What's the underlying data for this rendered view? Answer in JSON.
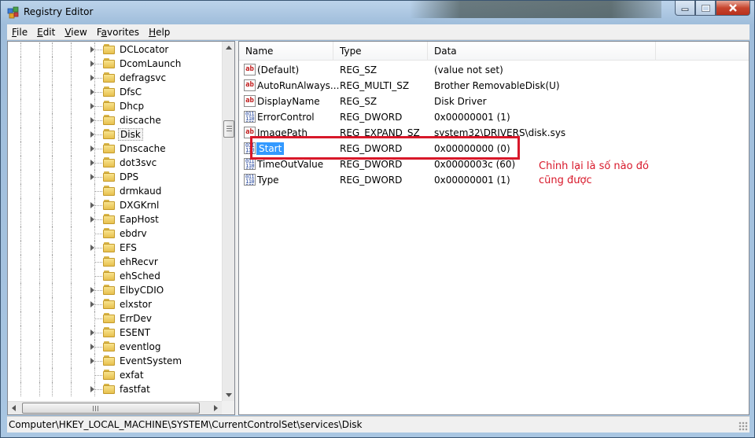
{
  "window": {
    "title": "Registry Editor",
    "app_icon": "registry-editor-icon",
    "buttons": {
      "minimize": "minimize-icon",
      "maximize": "maximize-icon",
      "close": "close-icon"
    }
  },
  "menu": [
    {
      "label": "File",
      "accel": "F",
      "rest": "ile"
    },
    {
      "label": "Edit",
      "accel": "E",
      "rest": "dit"
    },
    {
      "label": "View",
      "accel": "V",
      "rest": "iew"
    },
    {
      "label": "Favorites",
      "accel": "",
      "rest": "Favorites",
      "accel_index_note": "a"
    },
    {
      "label": "Help",
      "accel": "H",
      "rest": "elp"
    }
  ],
  "tree": {
    "items": [
      {
        "label": "DCLocator",
        "expandable": true
      },
      {
        "label": "DcomLaunch",
        "expandable": true
      },
      {
        "label": "defragsvc",
        "expandable": true
      },
      {
        "label": "DfsC",
        "expandable": true
      },
      {
        "label": "Dhcp",
        "expandable": true
      },
      {
        "label": "discache",
        "expandable": true
      },
      {
        "label": "Disk",
        "expandable": true,
        "selected": true
      },
      {
        "label": "Dnscache",
        "expandable": true
      },
      {
        "label": "dot3svc",
        "expandable": true
      },
      {
        "label": "DPS",
        "expandable": true
      },
      {
        "label": "drmkaud",
        "expandable": false
      },
      {
        "label": "DXGKrnl",
        "expandable": true
      },
      {
        "label": "EapHost",
        "expandable": true
      },
      {
        "label": "ebdrv",
        "expandable": false
      },
      {
        "label": "EFS",
        "expandable": true
      },
      {
        "label": "ehRecvr",
        "expandable": false
      },
      {
        "label": "ehSched",
        "expandable": false
      },
      {
        "label": "ElbyCDIO",
        "expandable": true
      },
      {
        "label": "elxstor",
        "expandable": true
      },
      {
        "label": "ErrDev",
        "expandable": false
      },
      {
        "label": "ESENT",
        "expandable": true
      },
      {
        "label": "eventlog",
        "expandable": true
      },
      {
        "label": "EventSystem",
        "expandable": true
      },
      {
        "label": "exfat",
        "expandable": false
      },
      {
        "label": "fastfat",
        "expandable": true
      }
    ]
  },
  "list": {
    "columns": [
      "Name",
      "Type",
      "Data"
    ],
    "rows": [
      {
        "name": "(Default)",
        "type": "REG_SZ",
        "data": "(value not set)",
        "icon": "string-value-icon"
      },
      {
        "name": "AutoRunAlways...",
        "type": "REG_MULTI_SZ",
        "data": "Brother RemovableDisk(U)",
        "icon": "string-value-icon"
      },
      {
        "name": "DisplayName",
        "type": "REG_SZ",
        "data": "Disk Driver",
        "icon": "string-value-icon"
      },
      {
        "name": "ErrorControl",
        "type": "REG_DWORD",
        "data": "0x00000001 (1)",
        "icon": "binary-value-icon"
      },
      {
        "name": "ImagePath",
        "type": "REG_EXPAND_SZ",
        "data": "system32\\DRIVERS\\disk.sys",
        "icon": "string-value-icon"
      },
      {
        "name": "Start",
        "type": "REG_DWORD",
        "data": "0x00000000 (0)",
        "icon": "binary-value-icon",
        "selected": true
      },
      {
        "name": "TimeOutValue",
        "type": "REG_DWORD",
        "data": "0x0000003c (60)",
        "icon": "binary-value-icon"
      },
      {
        "name": "Type",
        "type": "REG_DWORD",
        "data": "0x00000001 (1)",
        "icon": "binary-value-icon"
      }
    ]
  },
  "annotation": {
    "text": "Chỉnh lại là số nào đó cũng được",
    "color": "#d8182a"
  },
  "status": {
    "path": "Computer\\HKEY_LOCAL_MACHINE\\SYSTEM\\CurrentControlSet\\services\\Disk"
  },
  "colors": {
    "selection": "#3399ff",
    "annotation": "#d8182a"
  }
}
